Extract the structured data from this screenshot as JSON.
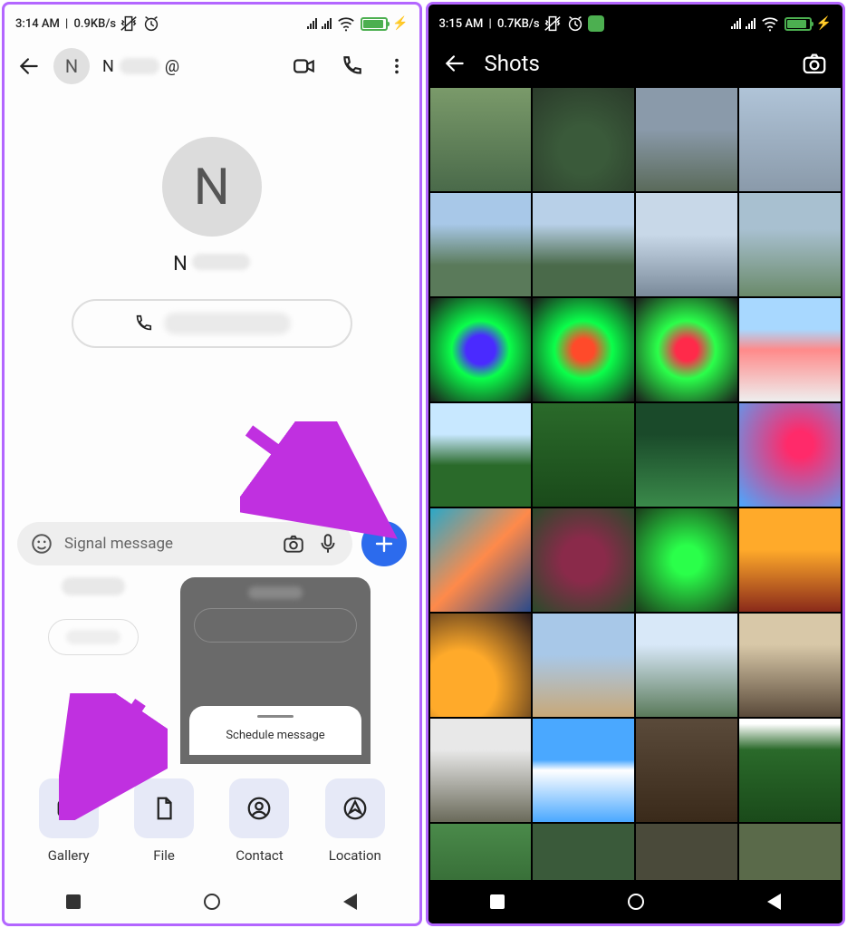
{
  "left": {
    "status": {
      "time": "3:14 AM",
      "speed": "0.9KB/s"
    },
    "header": {
      "avatar_letter": "N",
      "name_initial": "N",
      "at": "@"
    },
    "profile": {
      "avatar_letter": "N",
      "name_initial": "N"
    },
    "input": {
      "placeholder": "Signal message"
    },
    "schedule_label": "Schedule message",
    "attach": {
      "gallery": "Gallery",
      "file": "File",
      "contact": "Contact",
      "location": "Location"
    }
  },
  "right": {
    "status": {
      "time": "3:15 AM",
      "speed": "0.7KB/s"
    },
    "title": "Shots"
  }
}
